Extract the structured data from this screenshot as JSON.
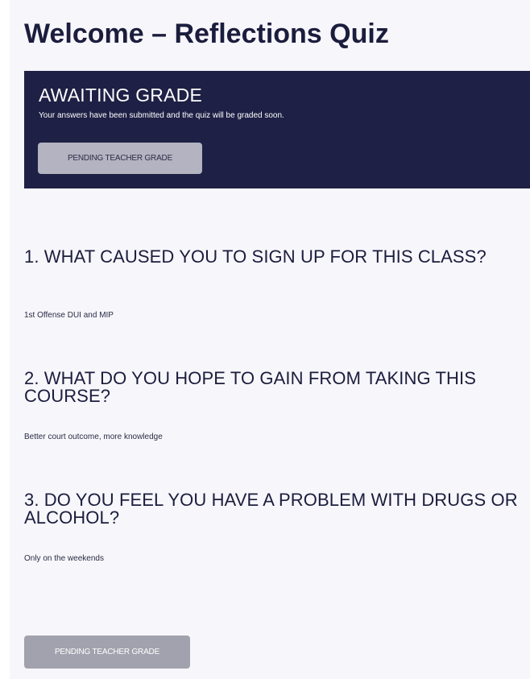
{
  "page": {
    "title": "Welcome – Reflections Quiz"
  },
  "status": {
    "title": "AWAITING GRADE",
    "message": "Your answers have been submitted and the quiz will be graded soon.",
    "button_label": "PENDING TEACHER GRADE"
  },
  "questions": [
    {
      "heading": "1. WHAT CAUSED YOU TO SIGN UP FOR THIS CLASS?",
      "answer": "1st Offense DUI and MIP"
    },
    {
      "heading": "2. WHAT DO YOU HOPE TO GAIN FROM TAKING THIS COURSE?",
      "answer": "Better court outcome, more knowledge"
    },
    {
      "heading": "3. DO YOU FEEL YOU HAVE A PROBLEM WITH DRUGS OR ALCOHOL?",
      "answer": "Only on the weekends"
    }
  ],
  "footer": {
    "button_label": "PENDING TEACHER GRADE"
  },
  "colors": {
    "background": "#f7f6fb",
    "banner": "#1e2045",
    "title_text": "#1b1d3d",
    "banner_button": "#b3b3c1",
    "footer_button": "#a1a2ae"
  }
}
